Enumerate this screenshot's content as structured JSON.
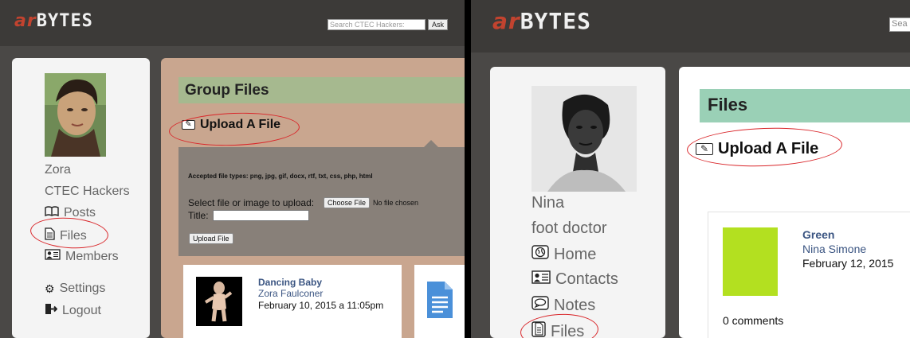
{
  "left": {
    "logo": {
      "ar": "ar",
      "bytes": "BYTES"
    },
    "search": {
      "placeholder": "Search CTEC Hackers:",
      "button": "Ask"
    },
    "profile": {
      "name": "Zora",
      "group": "CTEC Hackers"
    },
    "sidebar": {
      "posts": "Posts",
      "files": "Files",
      "members": "Members",
      "settings": "Settings",
      "logout": "Logout"
    },
    "main": {
      "title": "Group Files",
      "upload_link": "Upload A File",
      "accepted_types": "Accepted file types: png, jpg, gif, docx, rtf, txt, css, php, html",
      "select_label": "Select file or image to upload:",
      "choose_button": "Choose File",
      "no_file": "No file chosen",
      "title_label": "Title:",
      "submit_button": "Upload File"
    },
    "card": {
      "title": "Dancing Baby",
      "author": "Zora Faulconer",
      "date": "February 10, 2015 a 11:05pm"
    }
  },
  "right": {
    "logo": {
      "ar": "ar",
      "bytes": "BYTES"
    },
    "search": {
      "placeholder": "Sea"
    },
    "profile": {
      "name": "Nina",
      "role": "foot doctor"
    },
    "sidebar": {
      "home": "Home",
      "contacts": "Contacts",
      "notes": "Notes",
      "files": "Files"
    },
    "main": {
      "title": "Files",
      "upload_link": "Upload A File"
    },
    "card": {
      "title": "Green",
      "author": "Nina Simone",
      "date": "February 12, 2015",
      "comments": "0 comments",
      "swatch_color": "#b3e020"
    }
  },
  "colors": {
    "accent_red": "#c2432f",
    "annotation_red": "#d9262a",
    "link_blue": "#3b5582"
  }
}
